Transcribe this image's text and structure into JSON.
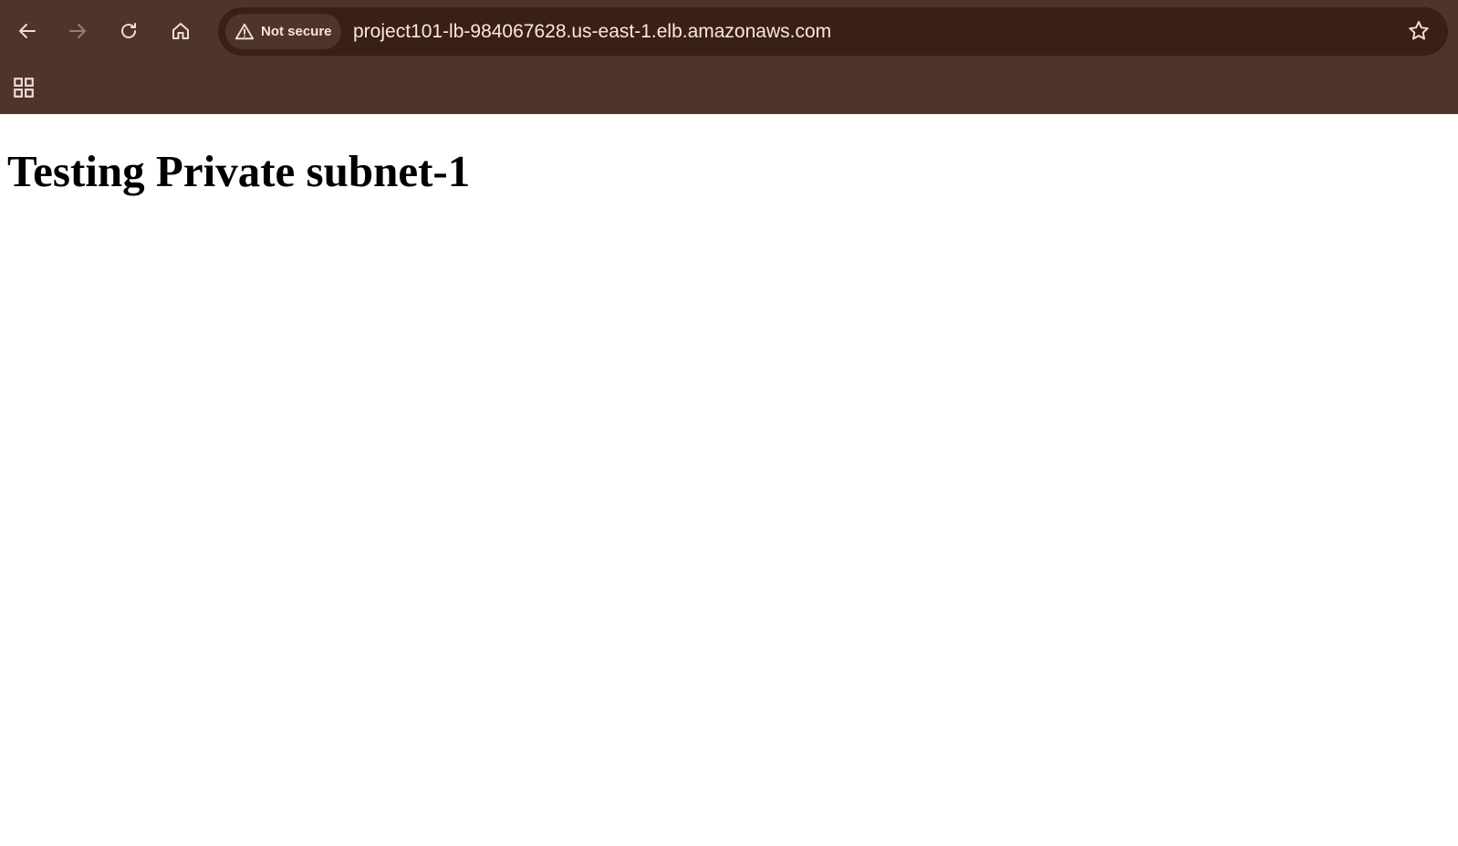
{
  "browser": {
    "security_label": "Not secure",
    "url": "project101-lb-984067628.us-east-1.elb.amazonaws.com",
    "icons": {
      "back": "arrow-left-icon",
      "forward": "arrow-right-icon",
      "reload": "reload-icon",
      "home": "home-icon",
      "security": "warning-triangle-icon",
      "bookmark": "star-icon",
      "apps": "apps-grid-icon"
    },
    "colors": {
      "chrome_bg": "#4e342b",
      "omnibox_bg": "#3a1f17",
      "icon": "#f1dfd7",
      "icon_disabled": "#9a7d72"
    }
  },
  "page": {
    "heading": "Testing Private subnet-1"
  }
}
